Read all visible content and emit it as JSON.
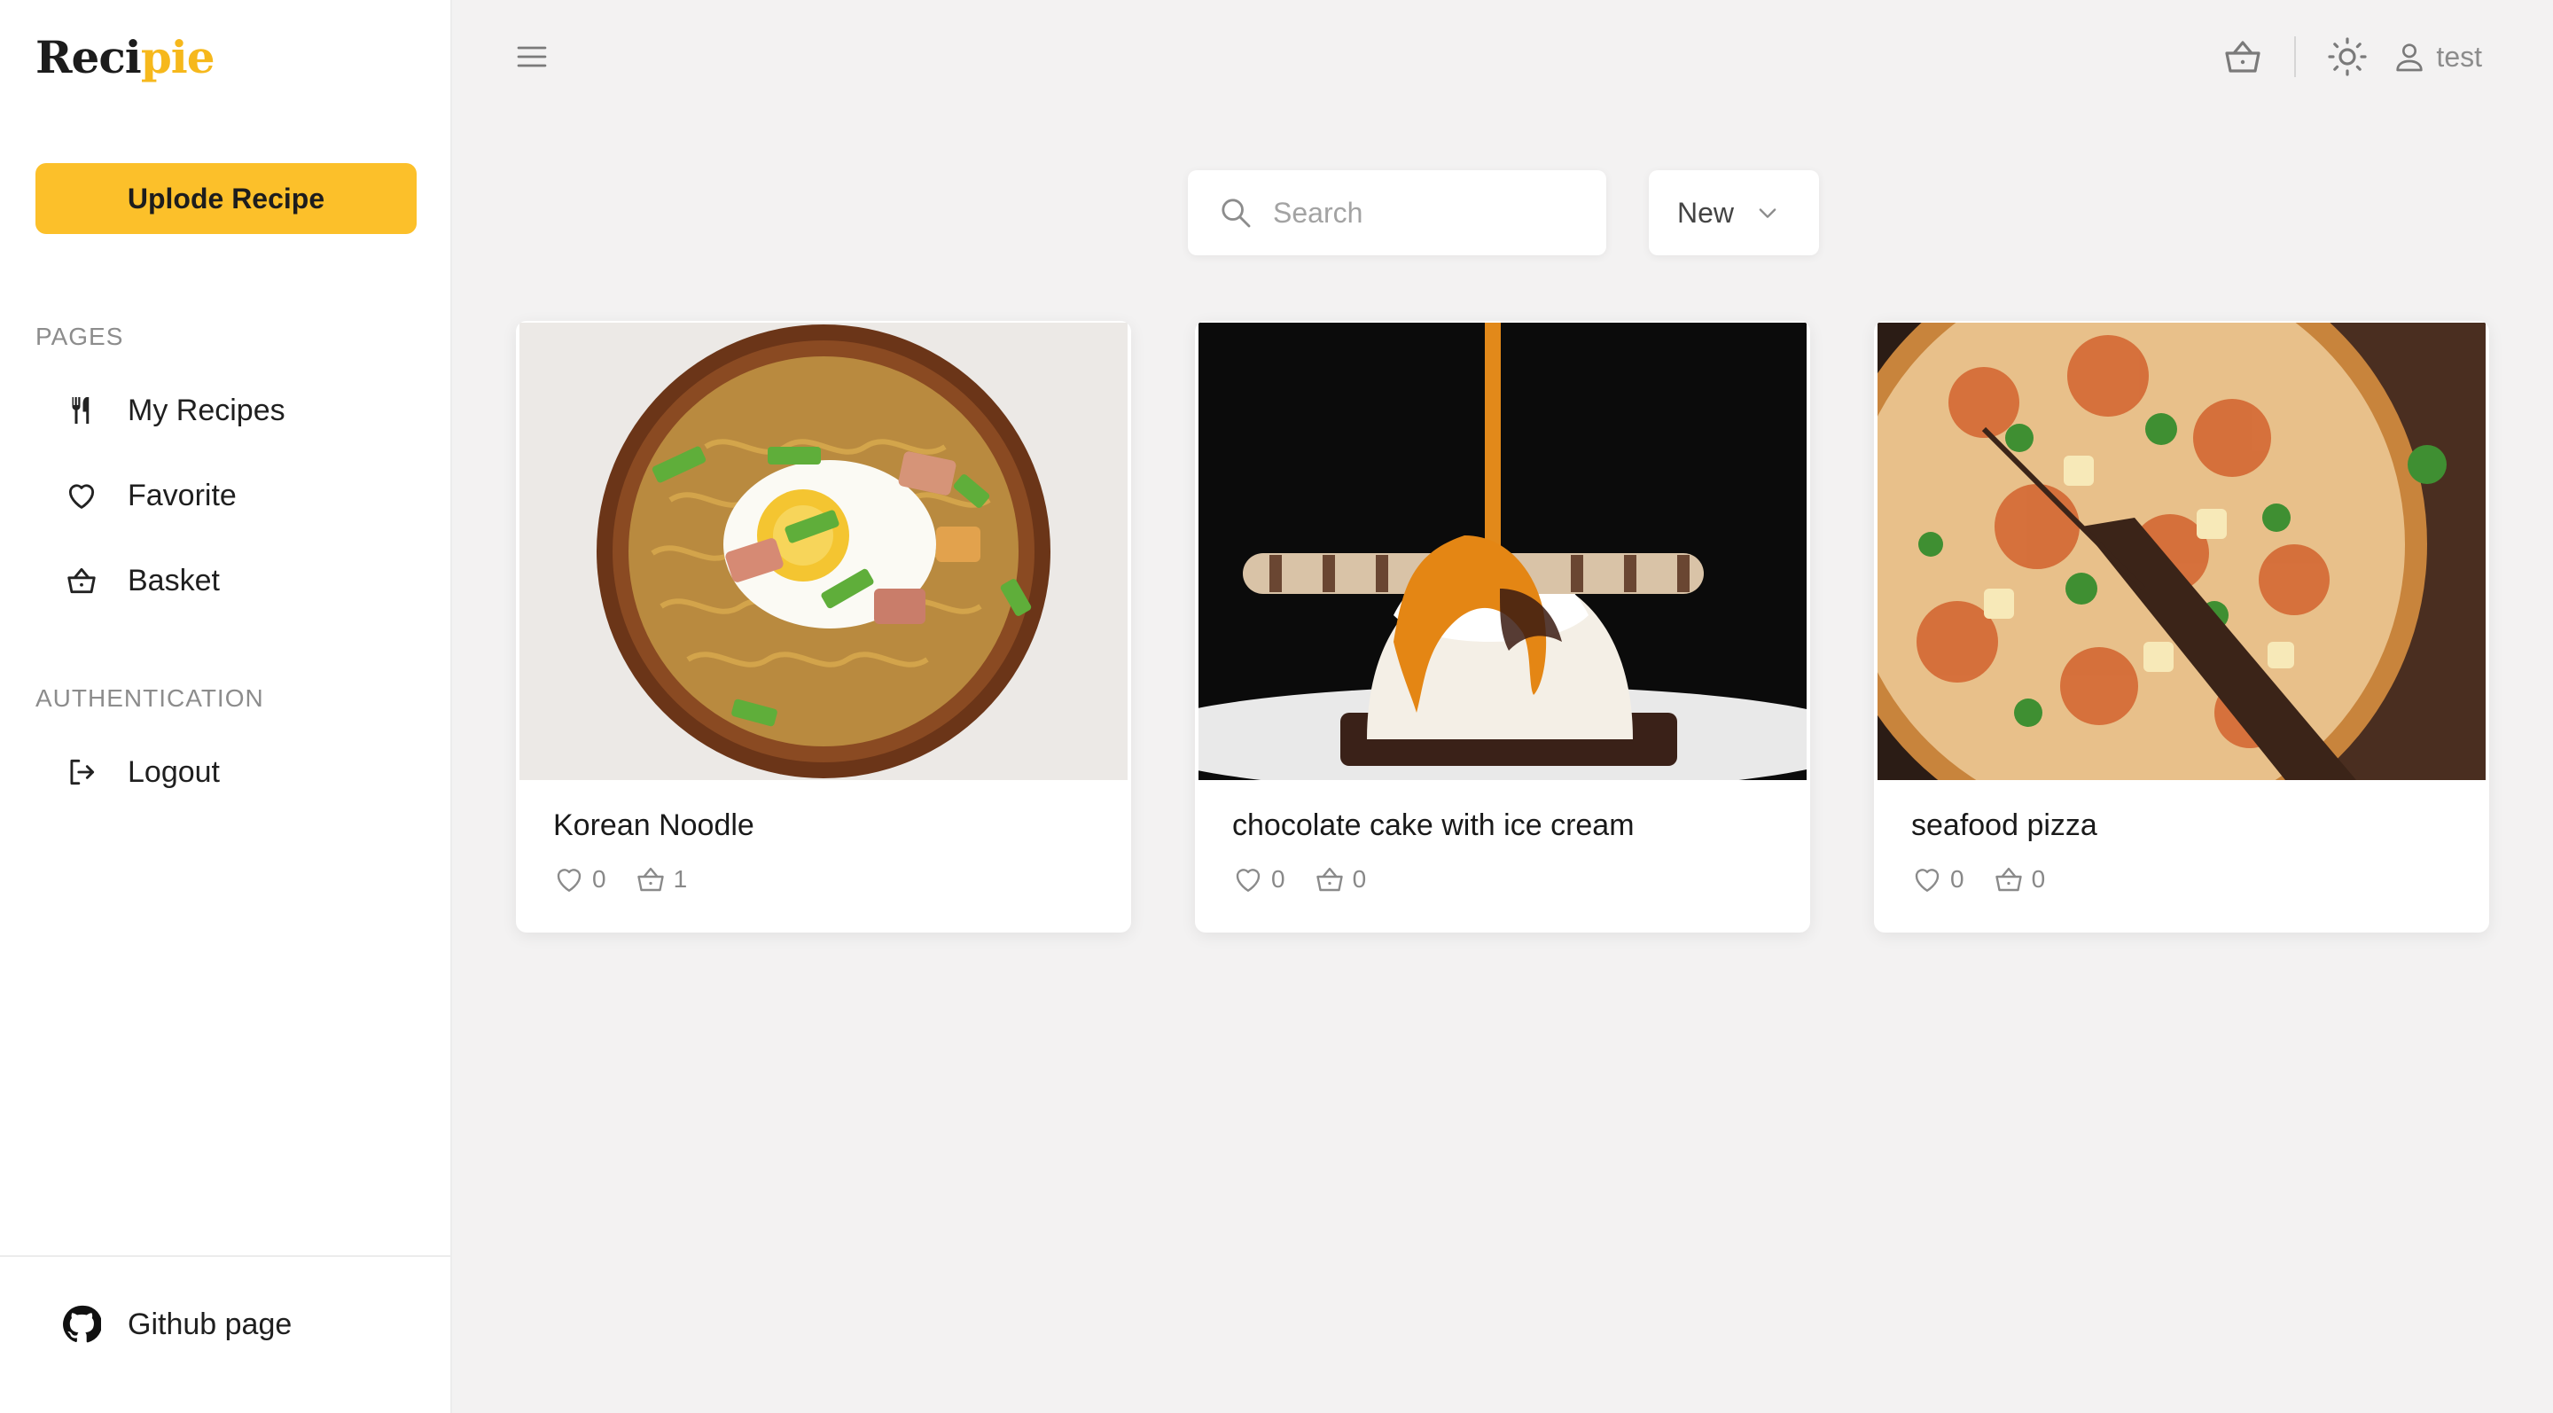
{
  "app": {
    "logo_part1": "Reci",
    "logo_part2": "pie"
  },
  "sidebar": {
    "upload_label": "Uplode Recipe",
    "pages_title": "PAGES",
    "pages": [
      {
        "label": "My Recipes",
        "icon": "fork-knife-icon"
      },
      {
        "label": "Favorite",
        "icon": "heart-icon"
      },
      {
        "label": "Basket",
        "icon": "basket-icon"
      }
    ],
    "auth_title": "AUTHENTICATION",
    "auth": [
      {
        "label": "Logout",
        "icon": "logout-icon"
      }
    ],
    "footer_label": "Github page"
  },
  "header": {
    "username": "test"
  },
  "search": {
    "placeholder": "Search",
    "value": ""
  },
  "sort": {
    "selected": "New"
  },
  "recipes": [
    {
      "title": "Korean Noodle",
      "likes": "0",
      "baskets": "1"
    },
    {
      "title": "chocolate cake with ice cream",
      "likes": "0",
      "baskets": "0"
    },
    {
      "title": "seafood pizza",
      "likes": "0",
      "baskets": "0"
    }
  ],
  "colors": {
    "accent": "#fcc02a",
    "logo_accent": "#f6b81c",
    "background": "#f3f2f2"
  }
}
